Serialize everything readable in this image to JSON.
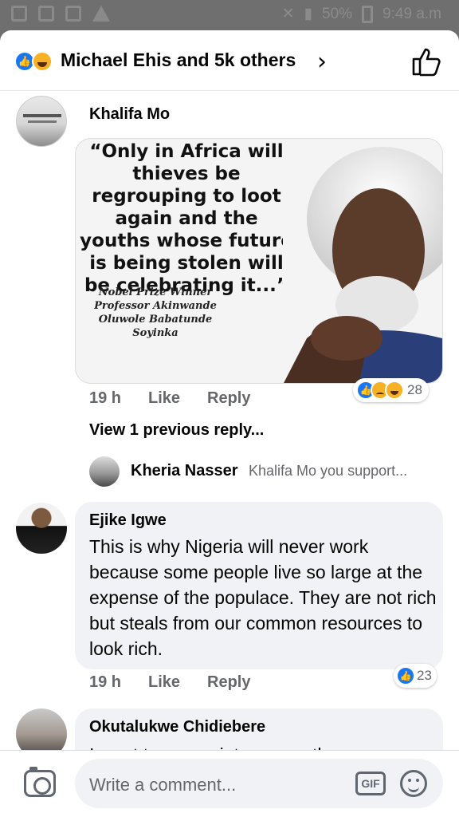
{
  "status_bar": {
    "battery": "50%",
    "time": "9:49 a.m"
  },
  "header": {
    "reactors": "Michael Ehis and 5k others",
    "reaction_icons": [
      "like-icon",
      "haha-icon"
    ],
    "chevron": "›"
  },
  "comments": [
    {
      "author": "Khalifa Mo",
      "image": {
        "quote": "“Only in Africa will thieves be regrouping to loot again and the youths whose future is being stolen will be celebrating it...”",
        "credit": [
          "Nobel Prize Winner",
          "Professor Akinwande",
          "Oluwole Babatunde Soyinka"
        ]
      },
      "time": "19 h",
      "like_label": "Like",
      "reply_label": "Reply",
      "reaction_icons": [
        "like-icon",
        "sad-icon",
        "haha-icon"
      ],
      "reaction_count": "28",
      "view_previous": "View 1 previous reply...",
      "reply_preview": {
        "author": "Kheria Nasser",
        "text": "Khalifa Mo you support..."
      }
    },
    {
      "author": "Ejike Igwe",
      "text": "This is why Nigeria will never work because some people live so large at the expense of the populace. They are not rich but steals  from our common resources to look rich.",
      "time": "19 h",
      "like_label": "Like",
      "reply_label": "Reply",
      "reaction_icons": [
        "like-icon"
      ],
      "reaction_count": "23"
    },
    {
      "author": "Okutalukwe Chidiebere",
      "text": "I want to appreciate our northern"
    }
  ],
  "composer": {
    "placeholder": "Write a comment...",
    "gif_label": "GIF"
  },
  "colors": {
    "accent": "#1877f2",
    "bubble": "#f0f2f5",
    "muted_text": "#65676b"
  }
}
